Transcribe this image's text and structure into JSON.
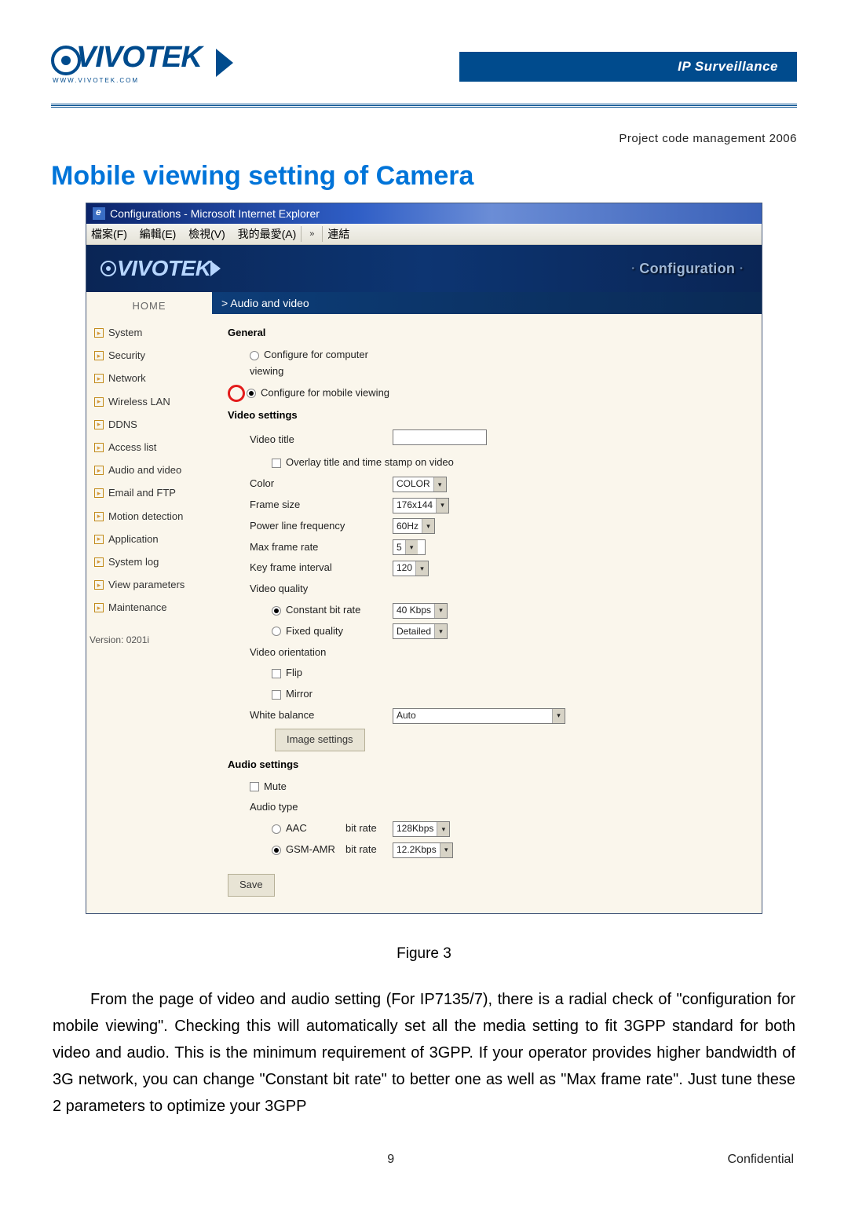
{
  "header": {
    "logo_text": "VIVOTEK",
    "logo_url": "WWW.VIVOTEK.COM",
    "band": "IP Surveillance"
  },
  "project_line": "Project code management 2006",
  "title": "Mobile viewing setting of Camera",
  "ie": {
    "title": "Configurations - Microsoft Internet Explorer",
    "menus": {
      "file": "檔案(F)",
      "edit": "編輯(E)",
      "view": "檢視(V)",
      "fav": "我的最愛(A)",
      "links": "連結"
    }
  },
  "inner": {
    "logo": "VIVOTEK",
    "config": "Configuration"
  },
  "sidebar": {
    "home": "HOME",
    "items": [
      "System",
      "Security",
      "Network",
      "Wireless LAN",
      "DDNS",
      "Access list",
      "Audio and video",
      "Email and FTP",
      "Motion detection",
      "Application",
      "System log",
      "View parameters",
      "Maintenance"
    ],
    "version": "Version: 0201i"
  },
  "panel": {
    "section": "> Audio and video",
    "general": "General",
    "opt_computer": "Configure for computer viewing",
    "opt_mobile": "Configure for mobile viewing",
    "video_settings": "Video settings",
    "video_title": "Video title",
    "overlay": "Overlay title and time stamp on video",
    "color_lbl": "Color",
    "color_val": "COLOR",
    "frame_lbl": "Frame size",
    "frame_val": "176x144",
    "power_lbl": "Power line frequency",
    "power_val": "60Hz",
    "maxfr_lbl": "Max frame rate",
    "maxfr_val": "5",
    "keyfr_lbl": "Key frame interval",
    "keyfr_val": "120",
    "vq_lbl": "Video quality",
    "cbr_lbl": "Constant bit rate",
    "cbr_val": "40 Kbps",
    "fq_lbl": "Fixed quality",
    "fq_val": "Detailed",
    "orient_lbl": "Video orientation",
    "flip": "Flip",
    "mirror": "Mirror",
    "wb_lbl": "White balance",
    "wb_val": "Auto",
    "img_btn": "Image settings",
    "audio_settings": "Audio settings",
    "mute": "Mute",
    "audio_type": "Audio type",
    "aac": "AAC",
    "gsm": "GSM-AMR",
    "bitrate": "bit rate",
    "aac_val": "128Kbps",
    "gsm_val": "12.2Kbps",
    "save": "Save"
  },
  "figure": "Figure 3",
  "body": "From the page of video and audio setting (For IP7135/7), there is a radial check of \"configuration for mobile viewing\". Checking this will automatically set all the media setting to fit 3GPP standard for both video and audio. This is the minimum requirement of 3GPP. If your operator provides higher bandwidth of 3G network, you can change \"Constant bit rate\" to better one as well as \"Max frame rate\". Just tune these 2 parameters to optimize your 3GPP",
  "footer": {
    "page": "9",
    "conf": "Confidential"
  }
}
